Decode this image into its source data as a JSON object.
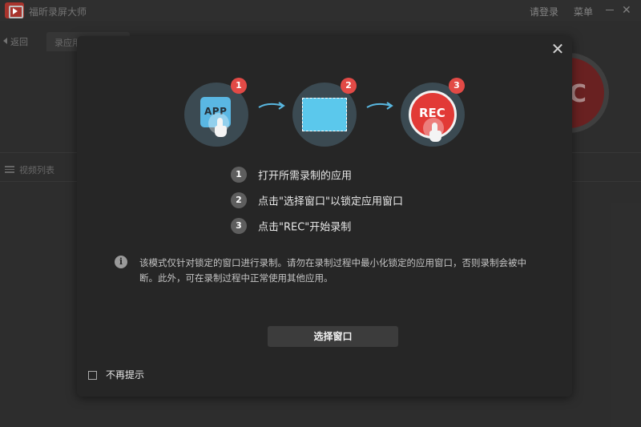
{
  "app": {
    "title": "福昕录屏大师",
    "login_label": "请登录",
    "menu_label": "菜单",
    "close_glyph": "✕",
    "back_label": "返回",
    "rec_tab_label": "录应用",
    "big_rec_label": "C",
    "video_list_label": "视频列表"
  },
  "dialog": {
    "close_glyph": "✕",
    "steps": [
      {
        "badge": "1",
        "icon": "app-icon",
        "icon_text": "APP"
      },
      {
        "badge": "2",
        "icon": "window-select-icon"
      },
      {
        "badge": "3",
        "icon": "rec-icon",
        "icon_text": "REC"
      }
    ],
    "instructions": [
      {
        "num": "1",
        "text": "打开所需录制的应用"
      },
      {
        "num": "2",
        "text": "点击\"选择窗口\"以锁定应用窗口"
      },
      {
        "num": "3",
        "text": "点击\"REC\"开始录制"
      }
    ],
    "info_glyph": "i",
    "note": "该模式仅针对锁定的窗口进行录制。请勿在录制过程中最小化锁定的应用窗口，否则录制会被中断。此外，可在录制过程中正常使用其他应用。",
    "select_window_button": "选择窗口",
    "dont_show_again": "不再提示"
  },
  "colors": {
    "badge_red": "#e24a46",
    "step_circle": "#3b4a52",
    "accent_blue": "#5bc8ec",
    "dialog_bg": "#262626"
  }
}
